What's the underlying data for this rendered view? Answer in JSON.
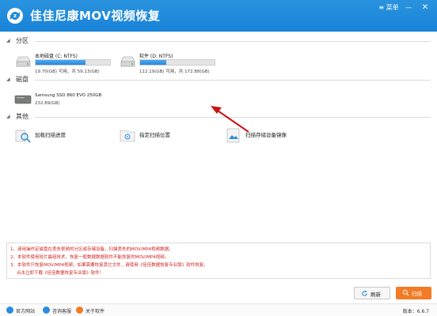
{
  "app": {
    "title": "佳佳尼康MOV视频恢复"
  },
  "window": {
    "menu_label": "菜单",
    "minimize": "—",
    "close": "✕"
  },
  "sections": {
    "partition": "分区",
    "disk": "磁盘",
    "other": "其他"
  },
  "partitions": [
    {
      "name": "本地磁盘 (C: NTFS)",
      "size": "19.70(GB) 可用，共 59.13(GB)",
      "used_fraction": 0.67
    },
    {
      "name": "软件 (D: NTFS)",
      "size": "112.19(GB) 可用，共 172.88(GB)",
      "used_fraction": 0.35
    }
  ],
  "disks": [
    {
      "name": "Samsung SSD 860 EVO 250GB",
      "size": "232.89(GB)"
    }
  ],
  "tools": [
    {
      "label": "加载扫描进度",
      "icon": "search-doc-icon"
    },
    {
      "label": "指定扫描位置",
      "icon": "target-icon"
    },
    {
      "label": "扫描存储设备镜像",
      "icon": "image-file-icon"
    }
  ],
  "notices": [
    "1、请用操作定磁盘在丢失视频的分区或存储设备，扫描丢失的MOV/MP4视频数据。",
    "2、本软件使用较片最组技术，恢复一般数据数据软件不能恢复的MOV/MP4视频。",
    "3、本软件只恢复MOV/MP4视频，如果需要恢复其它文件，请使用《佳佳数据恢复专业版》软件恢复。",
    "点击立即下载《佳佳数据恢复专业版》软件！"
  ],
  "buttons": {
    "refresh": "刷新",
    "scan": "扫描"
  },
  "statusbar": {
    "website": "官方网站",
    "support": "咨询客服",
    "about": "关于软件",
    "version": "版本：6.6.7"
  },
  "colors": {
    "accent": "#1f8ad9",
    "scan": "#f27b23",
    "notice": "#d21e1e"
  }
}
